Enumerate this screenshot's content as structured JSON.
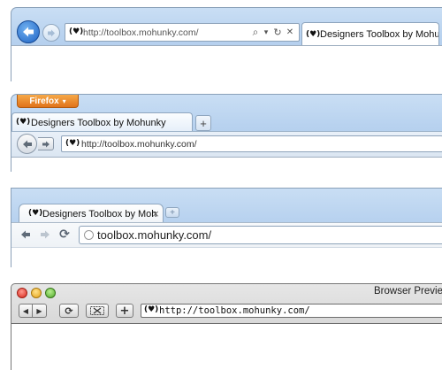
{
  "ie": {
    "url": "http://toolbox.mohunky.com/",
    "tab_label": "Designers Toolbox by Mohu",
    "favicon": "(♥)",
    "search_icon": "⌕",
    "dropdown_icon": "▾",
    "refresh_icon": "↻",
    "stop_icon": "✕"
  },
  "firefox": {
    "menu_label": "Firefox",
    "tab_label": "Designers Toolbox by Mohunky",
    "new_tab": "+",
    "url": "http://toolbox.mohunky.com/",
    "favicon": "(♥)"
  },
  "chrome": {
    "tab_label": "Designers Toolbox by Moh",
    "close": "×",
    "url": "toolbox.mohunky.com/",
    "favicon": "(♥)"
  },
  "safari": {
    "title": "Browser Preview",
    "url": "http://toolbox.mohunky.com/",
    "favicon": "(♥)",
    "add": "+"
  }
}
